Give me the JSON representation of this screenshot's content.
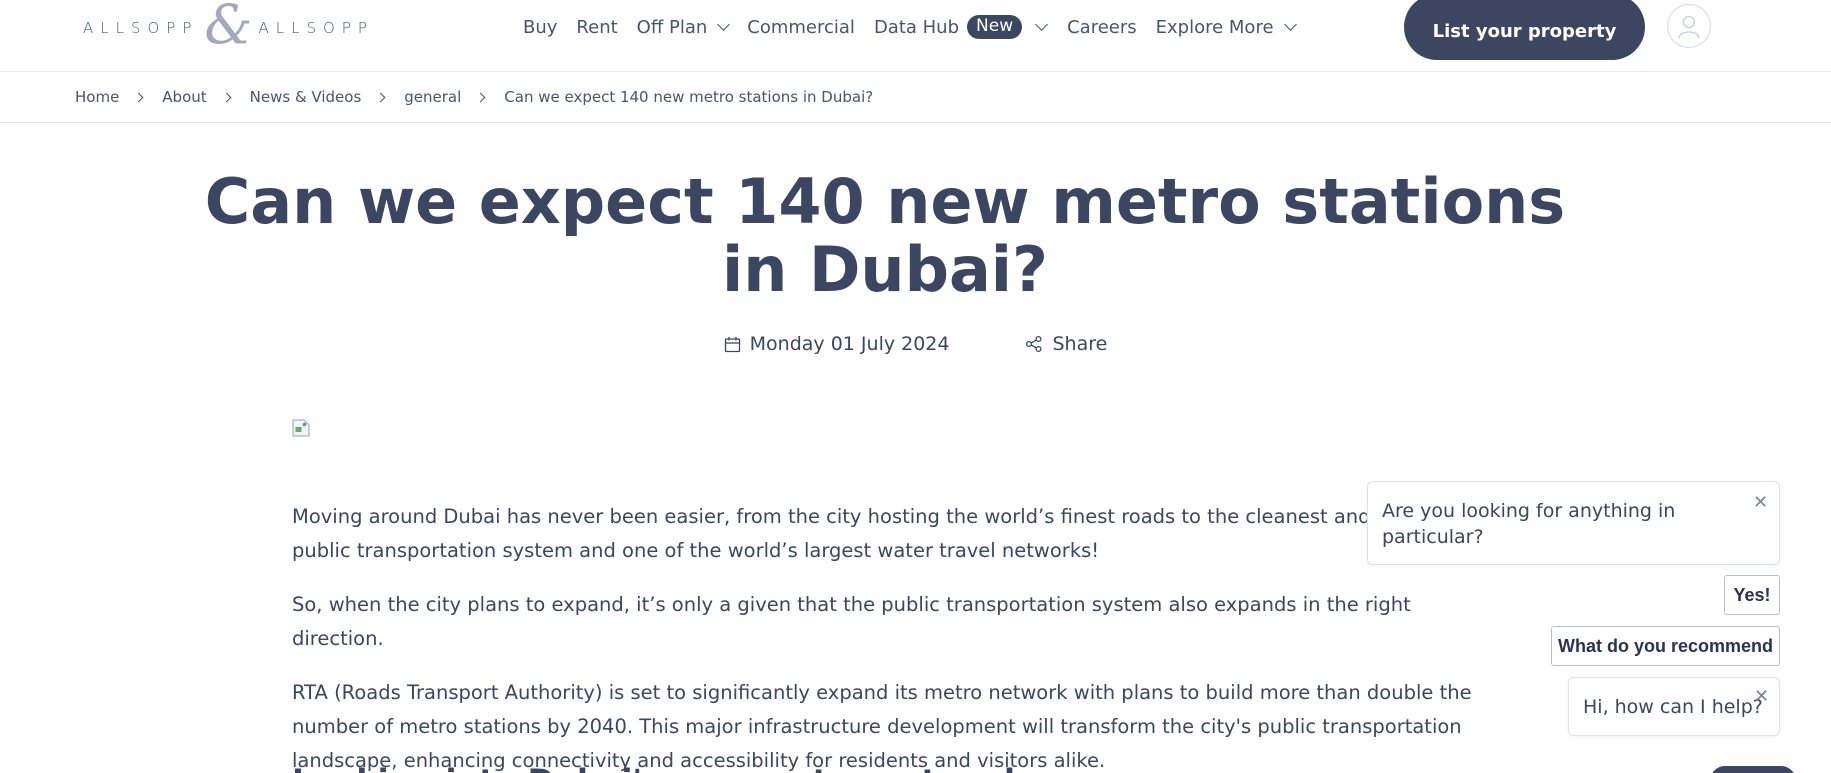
{
  "logo": {
    "left": "ALLSOPP",
    "amp": "&",
    "right": "ALLSOPP"
  },
  "nav": {
    "buy": "Buy",
    "rent": "Rent",
    "off_plan": "Off Plan",
    "commercial": "Commercial",
    "data_hub": "Data Hub",
    "new_badge": "New",
    "careers": "Careers",
    "explore_more": "Explore More"
  },
  "header": {
    "cta": "List your property"
  },
  "breadcrumb": {
    "home": "Home",
    "about": "About",
    "news": "News & Videos",
    "general": "general",
    "current": "Can we expect 140 new metro stations in Dubai?"
  },
  "article": {
    "title": "Can we expect 140 new metro stations in Dubai?",
    "date": "Monday 01 July 2024",
    "share": "Share",
    "paragraphs": [
      "Moving around Dubai has never been easier, from the city hosting the world’s finest roads to the cleanest and fastest public transportation system and one of the world’s largest water travel networks!",
      "So, when the city plans to expand, it’s only a given that the public transportation system also expands in the right direction.",
      "RTA (Roads Transport Authority) is set to significantly expand its metro network with plans to build more than double the number of metro stations by 2040. This major infrastructure development will transform the city's public transportation landscape, enhancing connectivity and accessibility for residents and visitors alike."
    ],
    "subheading": "Looking into Dubai's new metro network"
  },
  "chat": {
    "question": "Are you looking for anything in particular?",
    "yes": "Yes!",
    "recommend": "What do you recommend",
    "greeting": "Hi, how can I help?",
    "close": "✕"
  },
  "colors": {
    "brand_navy": "#3d4660",
    "text": "#3c4660",
    "logo_amp": "#a3a8be"
  }
}
